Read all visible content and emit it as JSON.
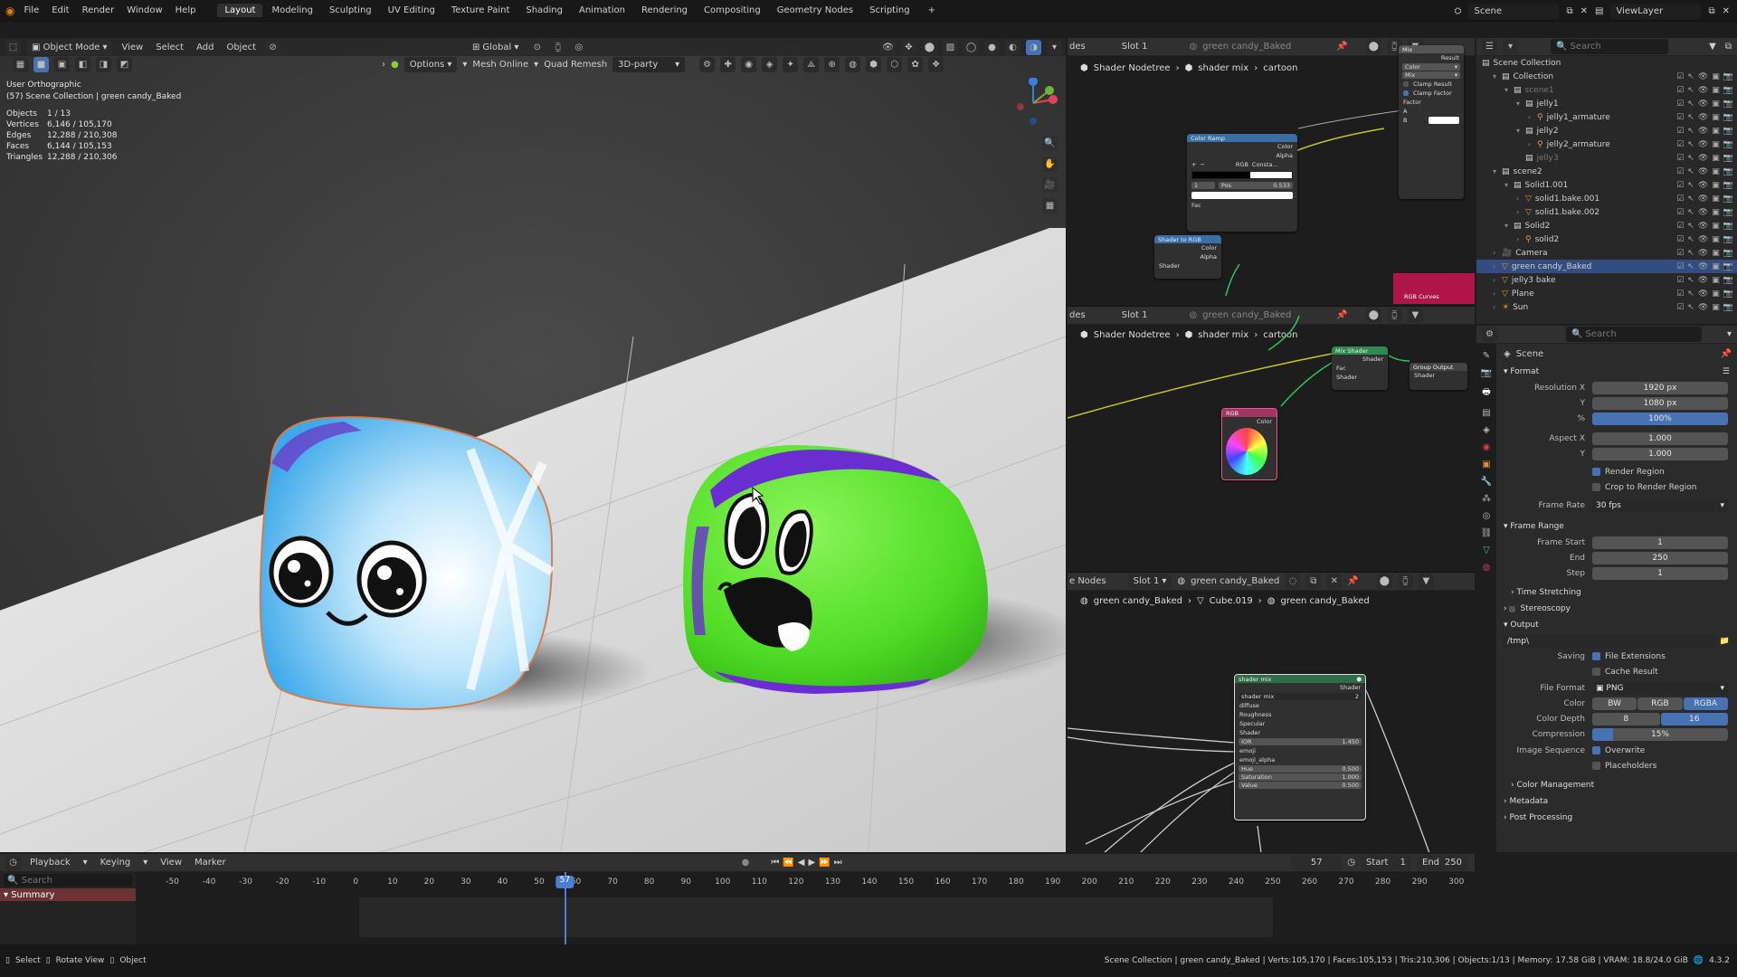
{
  "menu": [
    "File",
    "Edit",
    "Render",
    "Window",
    "Help"
  ],
  "workspaces": [
    {
      "label": "Layout",
      "active": true
    },
    {
      "label": "Modeling"
    },
    {
      "label": "Sculpting"
    },
    {
      "label": "UV Editing"
    },
    {
      "label": "Texture Paint"
    },
    {
      "label": "Shading"
    },
    {
      "label": "Animation"
    },
    {
      "label": "Rendering"
    },
    {
      "label": "Compositing"
    },
    {
      "label": "Geometry Nodes"
    },
    {
      "label": "Scripting"
    }
  ],
  "add_tab": "+",
  "top_right": {
    "scene": "Scene",
    "view_layer": "ViewLayer"
  },
  "viewport": {
    "mode": "Object Mode",
    "menus": [
      "View",
      "Select",
      "Add",
      "Object"
    ],
    "orientation": "Global",
    "options": "Options",
    "addon1": "Mesh Online",
    "addon2": "Quad Remesh",
    "addon3": "3D-party",
    "view_name": "User Orthographic",
    "collection_info": "(57) Scene Collection | green candy_Baked",
    "stats": [
      {
        "k": "Objects",
        "v": "1 / 13"
      },
      {
        "k": "Vertices",
        "v": "6,146 / 105,170"
      },
      {
        "k": "Edges",
        "v": "12,288 / 210,308"
      },
      {
        "k": "Faces",
        "v": "6,144 / 105,153"
      },
      {
        "k": "Triangles",
        "v": "12,288 / 210,306"
      }
    ]
  },
  "node1": {
    "editor": "des",
    "slot": "Slot 1",
    "material": "green candy_Baked",
    "crumbs": [
      "Shader Nodetree",
      "shader mix",
      "cartoon"
    ],
    "color_ramp": {
      "title": "Color Ramp",
      "out_color": "Color",
      "out_alpha": "Alpha",
      "rgb": "RGB",
      "interp": "Consta...",
      "pos_label": "Pos",
      "pos_value": "0.533",
      "fac": "Fac"
    },
    "shader_rgb": {
      "title": "Shader to RGB",
      "color": "Color",
      "alpha": "Alpha",
      "shader": "Shader"
    },
    "mix": {
      "title": "Mix",
      "result": "Result",
      "color": "Color",
      "mix": "Mix",
      "clamp_result": "Clamp Result",
      "clamp_factor": "Clamp Factor",
      "factor": "Factor",
      "a": "A",
      "b": "B"
    },
    "rgb_curves": "RGB Curves"
  },
  "node2": {
    "editor": "des",
    "slot": "Slot 1",
    "material": "green candy_Baked",
    "crumbs": [
      "Shader Nodetree",
      "shader mix",
      "cartoon"
    ],
    "mix_shader": {
      "title": "Mix Shader",
      "shader": "Shader",
      "fac": "Fac"
    },
    "group_output": {
      "title": "Group Output",
      "shader": "Shader"
    },
    "rgb": {
      "title": "RGB",
      "color": "Color"
    }
  },
  "node3": {
    "editor": "e Nodes",
    "slot": "Slot 1",
    "material": "green candy_Baked",
    "crumbs": [
      "green candy_Baked",
      "Cube.019",
      "green candy_Baked"
    ],
    "group": {
      "title": "shader mix",
      "shader": "Shader",
      "group_name": "shader mix",
      "users": "2",
      "inputs": [
        "diffuse",
        "Roughness",
        "Specular",
        "Shader"
      ],
      "ior_label": "IOR",
      "ior_value": "1.450",
      "more": [
        "emoji",
        "emoji_alpha"
      ],
      "hsv": [
        {
          "k": "Hue",
          "v": "0.500"
        },
        {
          "k": "Saturation",
          "v": "1.000"
        },
        {
          "k": "Value",
          "v": "0.500"
        }
      ]
    }
  },
  "outliner": {
    "search": "Search",
    "root": "Scene Collection",
    "rows": [
      {
        "label": "Collection",
        "depth": 0,
        "icon": "collection-icon",
        "tw": "▾"
      },
      {
        "label": "scene1",
        "depth": 1,
        "icon": "collection-icon",
        "tw": "▾",
        "dim": true
      },
      {
        "label": "jelly1",
        "depth": 2,
        "icon": "collection-icon",
        "tw": "▾"
      },
      {
        "label": "jelly1_armature",
        "depth": 3,
        "icon": "armature-icon",
        "tw": "›"
      },
      {
        "label": "jelly2",
        "depth": 2,
        "icon": "collection-icon",
        "tw": "▾"
      },
      {
        "label": "jelly2_armature",
        "depth": 3,
        "icon": "armature-icon",
        "tw": "›"
      },
      {
        "label": "jelly3",
        "depth": 2,
        "icon": "collection-icon",
        "tw": "",
        "dim": true
      },
      {
        "label": "scene2",
        "depth": 0,
        "icon": "collection-icon",
        "tw": "▾"
      },
      {
        "label": "Solid1.001",
        "depth": 1,
        "icon": "collection-icon",
        "tw": "▾"
      },
      {
        "label": "solid1.bake.001",
        "depth": 2,
        "icon": "mesh-icon",
        "tw": "›"
      },
      {
        "label": "solid1.bake.002",
        "depth": 2,
        "icon": "mesh-icon",
        "tw": "›"
      },
      {
        "label": "Solid2",
        "depth": 1,
        "icon": "collection-icon",
        "tw": "▾"
      },
      {
        "label": "solid2",
        "depth": 2,
        "icon": "armature-icon",
        "tw": "›"
      },
      {
        "label": "Camera",
        "depth": 0,
        "icon": "camera-icon",
        "tw": "›"
      },
      {
        "label": "green candy_Baked",
        "depth": 0,
        "icon": "mesh-icon",
        "tw": "›",
        "sel": true
      },
      {
        "label": "jelly3 bake",
        "depth": 0,
        "icon": "mesh-icon",
        "tw": "›"
      },
      {
        "label": "Plane",
        "depth": 0,
        "icon": "mesh-icon",
        "tw": "›"
      },
      {
        "label": "Sun",
        "depth": 0,
        "icon": "light-icon",
        "tw": "›"
      }
    ]
  },
  "properties": {
    "search": "Search",
    "context": "Scene",
    "format": "Format",
    "res_x_label": "Resolution X",
    "res_x": "1920 px",
    "res_y_label": "Y",
    "res_y": "1080 px",
    "res_pct_label": "%",
    "res_pct": "100%",
    "aspect_x_label": "Aspect X",
    "aspect_x": "1.000",
    "aspect_y_label": "Y",
    "aspect_y": "1.000",
    "render_region": "Render Region",
    "crop_region": "Crop to Render Region",
    "frame_rate_label": "Frame Rate",
    "frame_rate": "30 fps",
    "frame_range": "Frame Range",
    "frame_start_label": "Frame Start",
    "frame_start": "1",
    "frame_end_label": "End",
    "frame_end": "250",
    "frame_step_label": "Step",
    "frame_step": "1",
    "time_stretching": "Time Stretching",
    "stereoscopy": "Stereoscopy",
    "output": "Output",
    "path": "/tmp\\",
    "saving_label": "Saving",
    "file_ext": "File Extensions",
    "cache_result": "Cache Result",
    "file_format_label": "File Format",
    "file_format": "PNG",
    "color_label": "Color",
    "color_opts": [
      "BW",
      "RGB",
      "RGBA"
    ],
    "depth_label": "Color Depth",
    "depth_opts": [
      "8",
      "16"
    ],
    "compression_label": "Compression",
    "compression": "15%",
    "compression_frac": 0.15,
    "img_seq_label": "Image Sequence",
    "overwrite": "Overwrite",
    "placeholders": "Placeholders",
    "color_management": "Color Management",
    "metadata": "Metadata",
    "post_processing": "Post Processing"
  },
  "timeline": {
    "menus": [
      "Playback",
      "Keying",
      "View",
      "Marker"
    ],
    "search": "Search",
    "summary": "Summary",
    "current": "57",
    "start_label": "Start",
    "start": "1",
    "end_label": "End",
    "end": "250",
    "ticks": [
      "-50",
      "-40",
      "-30",
      "-20",
      "-10",
      "0",
      "10",
      "20",
      "30",
      "40",
      "50",
      "60",
      "70",
      "80",
      "90",
      "100",
      "110",
      "120",
      "130",
      "140",
      "150",
      "160",
      "170",
      "180",
      "190",
      "200",
      "210",
      "220",
      "230",
      "240",
      "250",
      "260",
      "270",
      "280",
      "290",
      "300"
    ],
    "range_min": -60,
    "range_max": 305,
    "frame_current": 57
  },
  "status": {
    "left": [
      "Select",
      "Rotate View",
      "Object"
    ],
    "right": "Scene Collection | green candy_Baked | Verts:105,170 | Faces:105,153 | Tris:210,306 | Objects:1/13 | Memory: 17.58 GiB | VRAM: 18.8/24.0 GiB",
    "version": "4.3.2"
  },
  "colors": {
    "accent": "#4772b3",
    "selected": "#334d80",
    "playhead": "#4b7fd4",
    "jelly_green": "#52e02a",
    "jelly_purple": "#6a2ed0",
    "candy_blue": "#4fb8f0"
  }
}
